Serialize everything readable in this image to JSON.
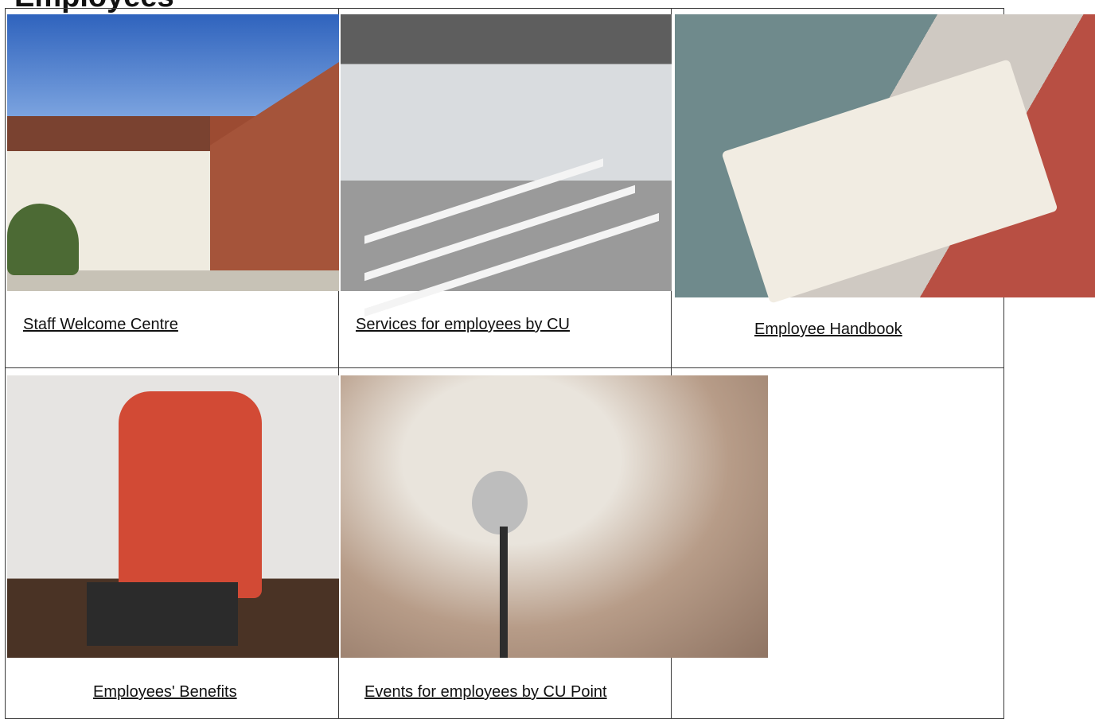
{
  "page": {
    "heading": "Employees"
  },
  "tiles": [
    {
      "label": "Staff Welcome Centre",
      "image": "staff-welcome-centre-photo"
    },
    {
      "label": "Services for employees by CU",
      "image": "lecture-room-photo"
    },
    {
      "label": "Employee Handbook",
      "image": "open-book-photo"
    },
    {
      "label": "Employees' Benefits",
      "image": "armchair-photo"
    },
    {
      "label": "Events for employees by CU Point",
      "image": "microphone-photo"
    }
  ]
}
